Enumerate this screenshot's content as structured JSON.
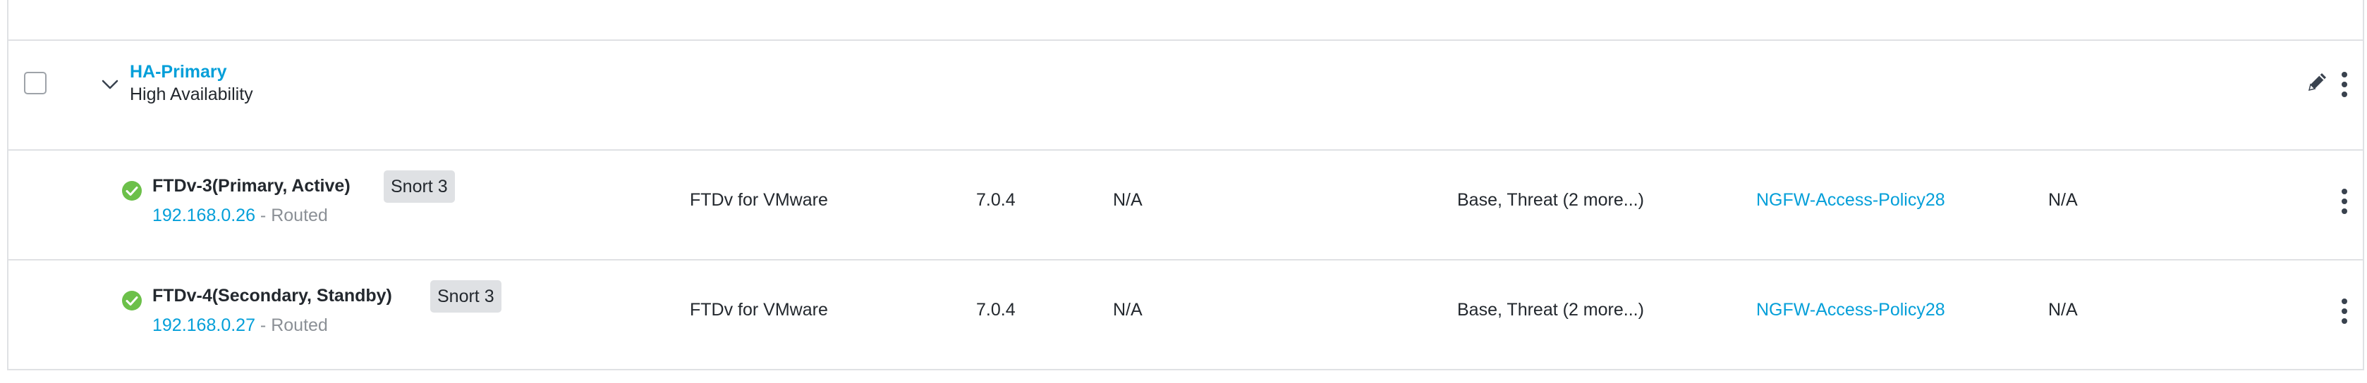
{
  "group": {
    "name": "HA-Primary",
    "type": "High Availability"
  },
  "devices": [
    {
      "name": "FTDv-3(Primary, Active)",
      "snort": "Snort 3",
      "ip": "192.168.0.26",
      "mode": " - Routed",
      "model": "FTDv for VMware",
      "version": "7.0.4",
      "chassis": "N/A",
      "licenses": "Base, Threat (2 more...)",
      "policy": "NGFW-Access-Policy28",
      "auto_rollback": "N/A",
      "status_color": "#6cc04a"
    },
    {
      "name": "FTDv-4(Secondary, Standby)",
      "snort": "Snort 3",
      "ip": "192.168.0.27",
      "mode": " - Routed",
      "model": "FTDv for VMware",
      "version": "7.0.4",
      "chassis": "N/A",
      "licenses": "Base, Threat (2 more...)",
      "policy": "NGFW-Access-Policy28",
      "auto_rollback": "N/A",
      "status_color": "#6cc04a"
    }
  ],
  "colors": {
    "link": "#049fd9",
    "border": "#dfe1e4",
    "badge_bg": "#dfe1e4",
    "text": "#23282e",
    "muted": "#8b9096"
  },
  "icons": {
    "chevron": "chevron-down-icon",
    "edit": "pencil-icon",
    "menu": "more-vertical-icon",
    "status": "check-circle-icon"
  }
}
